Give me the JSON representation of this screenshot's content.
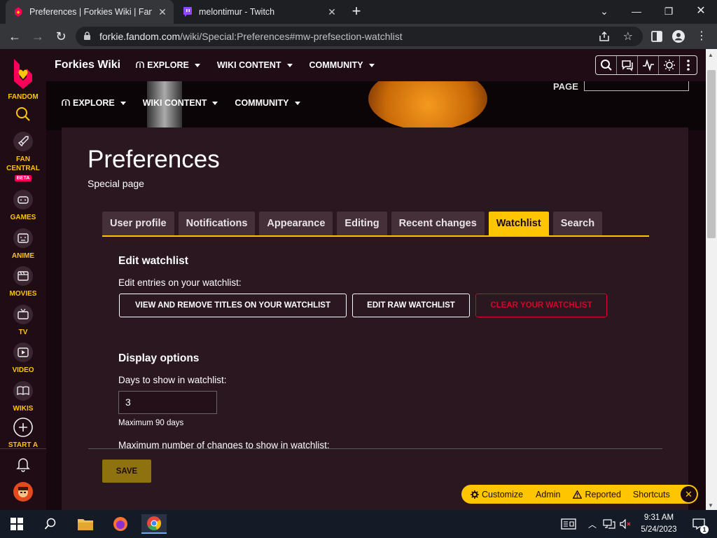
{
  "browser": {
    "tabs": [
      {
        "title": "Preferences | Forkies Wiki | Fandom",
        "active": true
      },
      {
        "title": "melontimur - Twitch",
        "active": false
      }
    ],
    "url_host": "forkie.fandom.com",
    "url_path": "/wiki/Special:Preferences#mw-prefsection-watchlist"
  },
  "sidebar": {
    "brand": "FANDOM",
    "items": [
      {
        "label": "FAN",
        "label2": "CENTRAL",
        "badge": "BETA",
        "icon": "rocket-icon"
      },
      {
        "label": "GAMES",
        "icon": "gamepad-icon"
      },
      {
        "label": "ANIME",
        "icon": "anime-icon"
      },
      {
        "label": "MOVIES",
        "icon": "movies-icon"
      },
      {
        "label": "TV",
        "icon": "tv-icon"
      },
      {
        "label": "VIDEO",
        "icon": "video-icon"
      },
      {
        "label": "WIKIS",
        "icon": "book-icon"
      },
      {
        "label": "START A",
        "icon": "plus-circle-icon"
      }
    ]
  },
  "topnav": {
    "wiki_name": "Forkies Wiki",
    "items": [
      "EXPLORE",
      "WIKI CONTENT",
      "COMMUNITY"
    ]
  },
  "hero": {
    "page_label": "PAGE"
  },
  "subnav": {
    "items": [
      "EXPLORE",
      "WIKI CONTENT",
      "COMMUNITY"
    ]
  },
  "page": {
    "title": "Preferences",
    "subtitle": "Special page",
    "tabs": [
      "User profile",
      "Notifications",
      "Appearance",
      "Editing",
      "Recent changes",
      "Watchlist",
      "Search"
    ],
    "active_tab": "Watchlist",
    "edit_watchlist": {
      "heading": "Edit watchlist",
      "description": "Edit entries on your watchlist:",
      "buttons": [
        "VIEW AND REMOVE TITLES ON YOUR WATCHLIST",
        "EDIT RAW WATCHLIST",
        "CLEAR YOUR WATCHLIST"
      ]
    },
    "display_options": {
      "heading": "Display options",
      "days_label": "Days to show in watchlist:",
      "days_value": "3",
      "days_hint": "Maximum 90 days",
      "max_changes_label": "Maximum number of changes to show in watchlist:"
    },
    "save_label": "SAVE"
  },
  "toolbar": {
    "items": [
      "Customize",
      "Admin",
      "Reported",
      "Shortcuts"
    ]
  },
  "taskbar": {
    "time": "9:31 AM",
    "date": "5/24/2023",
    "notification_count": "1"
  },
  "colors": {
    "accent": "#ffc500",
    "brand": "#fa005a",
    "danger": "#d9002b",
    "page_bg": "#2b1720"
  }
}
